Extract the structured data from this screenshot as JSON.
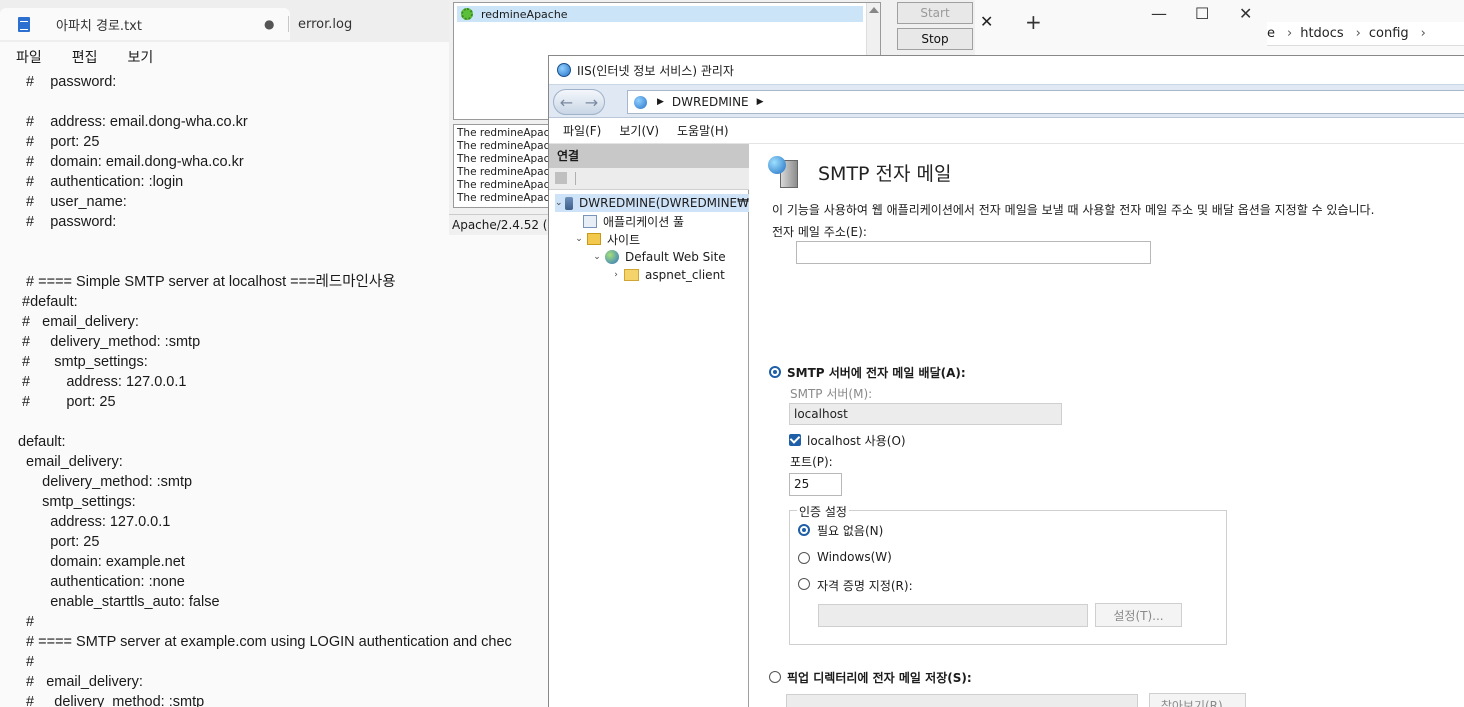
{
  "notepad": {
    "tabs": [
      {
        "label": "아파치 경로.txt",
        "modified_dot": "●"
      },
      {
        "label": "error.log"
      }
    ],
    "menu": [
      "파일",
      "편집",
      "보기"
    ],
    "lines": [
      "  #    password:",
      "",
      "  #    address: email.dong-wha.co.kr",
      "  #    port: 25",
      "  #    domain: email.dong-wha.co.kr",
      "  #    authentication: :login",
      "  #    user_name:",
      "  #    password:",
      "",
      "",
      "  # ==== Simple SMTP server at localhost ===레드마인사용",
      " #default:",
      " #   email_delivery:",
      " #     delivery_method: :smtp",
      " #      smtp_settings:",
      " #         address: 127.0.0.1",
      " #         port: 25",
      "",
      "default:",
      "  email_delivery:",
      "      delivery_method: :smtp",
      "      smtp_settings:",
      "        address: 127.0.0.1",
      "        port: 25",
      "        domain: example.net",
      "        authentication: :none",
      "        enable_starttls_auto: false",
      "  #",
      "  # ==== SMTP server at example.com using LOGIN authentication and chec",
      "  #",
      "  #   email_delivery:",
      "  #     delivery_method: :smtp"
    ]
  },
  "apache": {
    "service": "redmineApache",
    "start_label": "Start",
    "stop_label": "Stop",
    "log": [
      "The redmineApach",
      "The redmineApach",
      "The redmineApach",
      "The redmineApach",
      "The redmineApach",
      "The redmineApach"
    ],
    "status": "Apache/2.4.52 (W"
  },
  "explorer": {
    "close_glyph": "✕",
    "newtab_glyph": "+",
    "min_glyph": "—",
    "max_glyph": "☐",
    "winclose_glyph": "✕",
    "crumbs": [
      "e",
      "htdocs",
      "config"
    ],
    "sep": "›"
  },
  "iis": {
    "title": "IIS(인터넷 정보 서비스) 관리자",
    "back_glyph": "←",
    "forward_glyph": "→",
    "address": "DWREDMINE",
    "addr_arrow": "▶",
    "menu": [
      "파일(F)",
      "보기(V)",
      "도움말(H)"
    ],
    "connections": {
      "header": "연결",
      "tree": [
        {
          "label": "DWREDMINE(DWREDMINE₩",
          "exp": "⌄"
        },
        {
          "label": "애플리케이션 풀",
          "exp": ""
        },
        {
          "label": "사이트",
          "exp": "⌄"
        },
        {
          "label": "Default Web Site",
          "exp": "⌄"
        },
        {
          "label": "aspnet_client",
          "exp": "›"
        }
      ]
    },
    "feature": {
      "title": "SMTP 전자 메일",
      "description": "이 기능을 사용하여 웹 애플리케이션에서 전자 메일을 보낼 때 사용할 전자 메일 주소 및 배달 옵션을 지정할 수 있습니다.",
      "email_label": "전자 메일 주소(E):",
      "email_value": "",
      "smtp_option_label": "SMTP 서버에 전자 메일 배달(A):",
      "smtp_server_label": "SMTP 서버(M):",
      "smtp_server_value": "localhost",
      "use_localhost_label": "localhost 사용(O)",
      "port_label": "포트(P):",
      "port_value": "25",
      "auth_group_label": "인증 설정",
      "auth_none_label": "필요 없음(N)",
      "auth_windows_label": "Windows(W)",
      "auth_credentials_label": "자격 증명 지정(R):",
      "auth_set_button": "설정(T)...",
      "pickup_option_label": "픽업 디렉터리에 전자 메일 저장(S):",
      "browse_button": "찾아보기(R)..."
    }
  }
}
